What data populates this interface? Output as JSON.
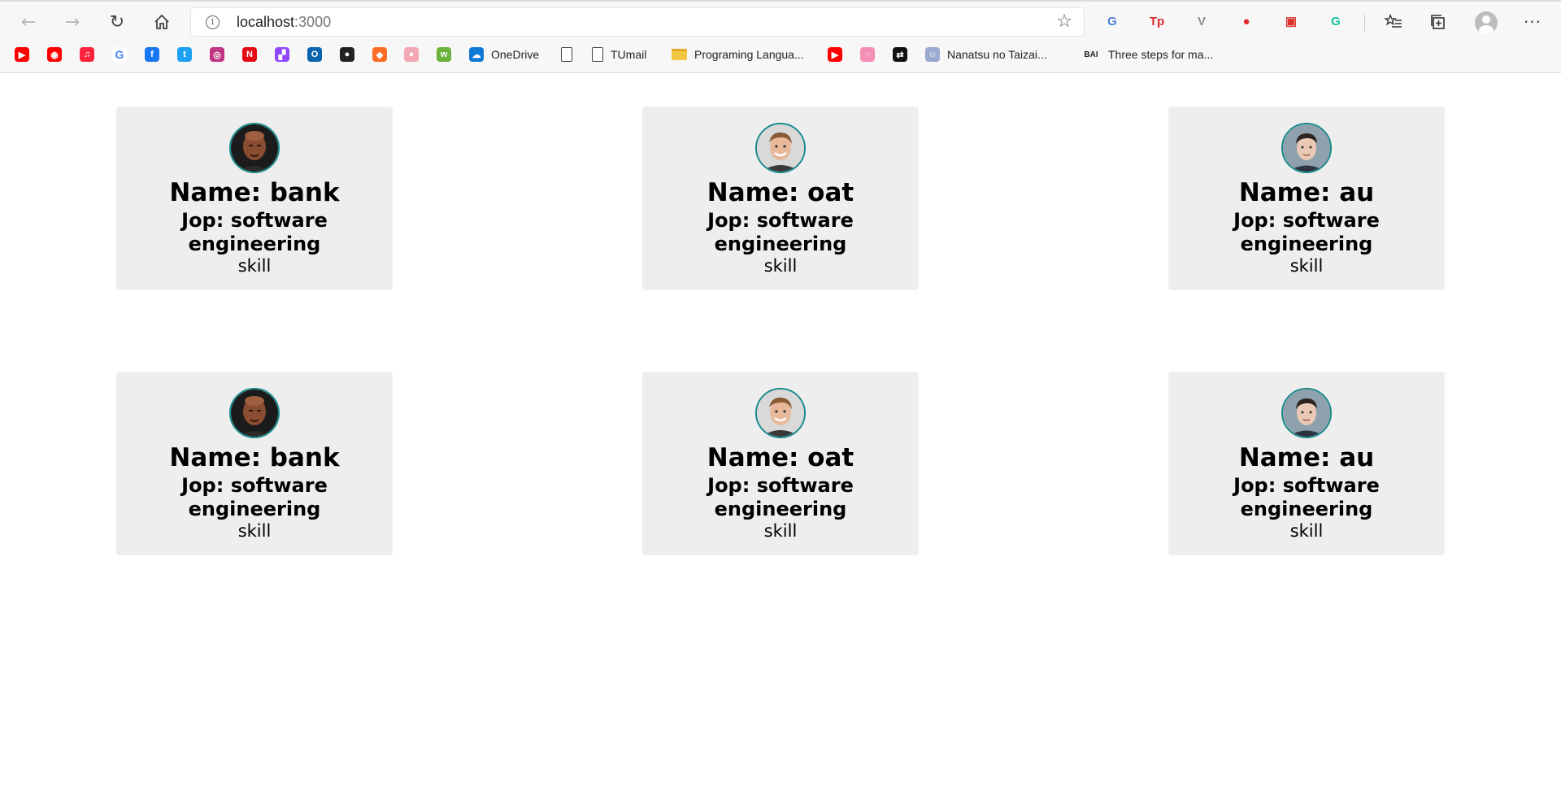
{
  "browser": {
    "url_host": "localhost",
    "url_port": ":3000",
    "nav_icons": [
      "back-arrow-icon",
      "forward-arrow-icon",
      "refresh-icon",
      "home-icon"
    ],
    "extensions": [
      {
        "name": "google-translate-icon",
        "glyph": "G",
        "color": "#4a7ee0"
      },
      {
        "name": "tp-extension-icon",
        "glyph": "Tp",
        "color": "#e0282e"
      },
      {
        "name": "v-extension-icon",
        "glyph": "V",
        "color": "#8e8e8e"
      },
      {
        "name": "opera-adblock-icon",
        "glyph": "●",
        "color": "#e0282e"
      },
      {
        "name": "red-extension-icon",
        "glyph": "▣",
        "color": "#d9312a"
      },
      {
        "name": "grammarly-icon",
        "glyph": "G",
        "color": "#15c39a"
      }
    ]
  },
  "bookmarks": [
    {
      "name": "youtube-icon",
      "label": "",
      "color": "#ff0000",
      "glyph": "▶"
    },
    {
      "name": "youtube-music-icon",
      "label": "",
      "color": "#ff0000",
      "glyph": "◉"
    },
    {
      "name": "apple-music-icon",
      "label": "",
      "color": "#fa243c",
      "glyph": "♫"
    },
    {
      "name": "google-icon",
      "label": "",
      "color": "#ffffff",
      "glyph": "G"
    },
    {
      "name": "facebook-icon",
      "label": "",
      "color": "#1877f2",
      "glyph": "f"
    },
    {
      "name": "twitter-icon",
      "label": "",
      "color": "#1da1f2",
      "glyph": "t"
    },
    {
      "name": "instagram-icon",
      "label": "",
      "color": "#c13584",
      "glyph": "◎"
    },
    {
      "name": "netflix-icon",
      "label": "",
      "color": "#e50914",
      "glyph": "N"
    },
    {
      "name": "twitch-icon",
      "label": "",
      "color": "#9146ff",
      "glyph": "▞"
    },
    {
      "name": "outlook-icon",
      "label": "",
      "color": "#0a64ad",
      "glyph": "O"
    },
    {
      "name": "github-icon",
      "label": "",
      "color": "#222222",
      "glyph": "●"
    },
    {
      "name": "gitlab-icon",
      "label": "",
      "color": "#fc6d26",
      "glyph": "◆"
    },
    {
      "name": "pig-icon",
      "label": "",
      "color": "#f3a6b4",
      "glyph": "●"
    },
    {
      "name": "green-app-icon",
      "label": "",
      "color": "#6ab43e",
      "glyph": "w"
    },
    {
      "name": "onedrive-icon",
      "label": "OneDrive",
      "color": "#0f78d4",
      "glyph": "☁"
    },
    {
      "name": "document-icon",
      "label": "",
      "color": "",
      "glyph": ""
    },
    {
      "name": "tumail-icon",
      "label": "TUmail",
      "color": "",
      "glyph": ""
    },
    {
      "name": "folder-icon",
      "label": "Programing Langua...",
      "color": "",
      "glyph": ""
    },
    {
      "name": "youtube-icon-2",
      "label": "",
      "color": "#ff0000",
      "glyph": "▶"
    },
    {
      "name": "pink-app-icon",
      "label": "",
      "color": "#f58fb5",
      "glyph": "◌"
    },
    {
      "name": "black-app-icon",
      "label": "",
      "color": "#111111",
      "glyph": "⇄"
    },
    {
      "name": "nanatsu-icon",
      "label": "Nanatsu no Taizai...",
      "color": "#9ba8cf",
      "glyph": "☺"
    },
    {
      "name": "bai-icon",
      "label": "Three steps for ma...",
      "color": "",
      "glyph": "BAI"
    }
  ],
  "cards": [
    {
      "name_line": "Name: bank",
      "job_line": "Jop: software engineering",
      "skill_line": "skill",
      "avatar": "avatar-bank"
    },
    {
      "name_line": "Name: oat",
      "job_line": "Jop: software engineering",
      "skill_line": "skill",
      "avatar": "avatar-oat"
    },
    {
      "name_line": "Name: au",
      "job_line": "Jop: software engineering",
      "skill_line": "skill",
      "avatar": "avatar-au"
    },
    {
      "name_line": "Name: bank",
      "job_line": "Jop: software engineering",
      "skill_line": "skill",
      "avatar": "avatar-bank"
    },
    {
      "name_line": "Name: oat",
      "job_line": "Jop: software engineering",
      "skill_line": "skill",
      "avatar": "avatar-oat"
    },
    {
      "name_line": "Name: au",
      "job_line": "Jop: software engineering",
      "skill_line": "skill",
      "avatar": "avatar-au"
    }
  ],
  "colors": {
    "card_background": "#eeeeee",
    "avatar_border": "#1a8a8a"
  }
}
